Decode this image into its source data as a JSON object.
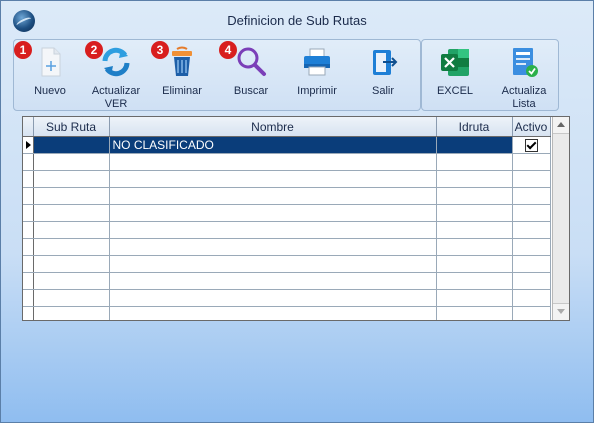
{
  "window": {
    "title": "Definicion de Sub Rutas"
  },
  "toolbar": {
    "buttons": [
      {
        "label": "Nuevo",
        "badge": "1",
        "icon": "new-document-icon"
      },
      {
        "label": "Actualizar VER",
        "badge": "2",
        "icon": "refresh-icon"
      },
      {
        "label": "Eliminar",
        "badge": "3",
        "icon": "trash-icon"
      },
      {
        "label": "Buscar",
        "badge": "4",
        "icon": "magnifier-icon"
      },
      {
        "label": "Imprimir",
        "icon": "printer-icon"
      },
      {
        "label": "Salir",
        "icon": "exit-door-icon"
      },
      {
        "label": "EXCEL",
        "icon": "excel-icon"
      },
      {
        "label": "Actualiza Lista",
        "icon": "update-list-icon"
      }
    ]
  },
  "grid": {
    "columns": [
      "Sub Ruta",
      "Nombre",
      "Idruta",
      "Activo"
    ],
    "rows": [
      {
        "sub_ruta": "",
        "nombre": "NO CLASIFICADO",
        "idruta": "",
        "activo": true
      }
    ]
  },
  "colors": {
    "accent": "#0a3d7a",
    "badge": "#d81e1e"
  }
}
